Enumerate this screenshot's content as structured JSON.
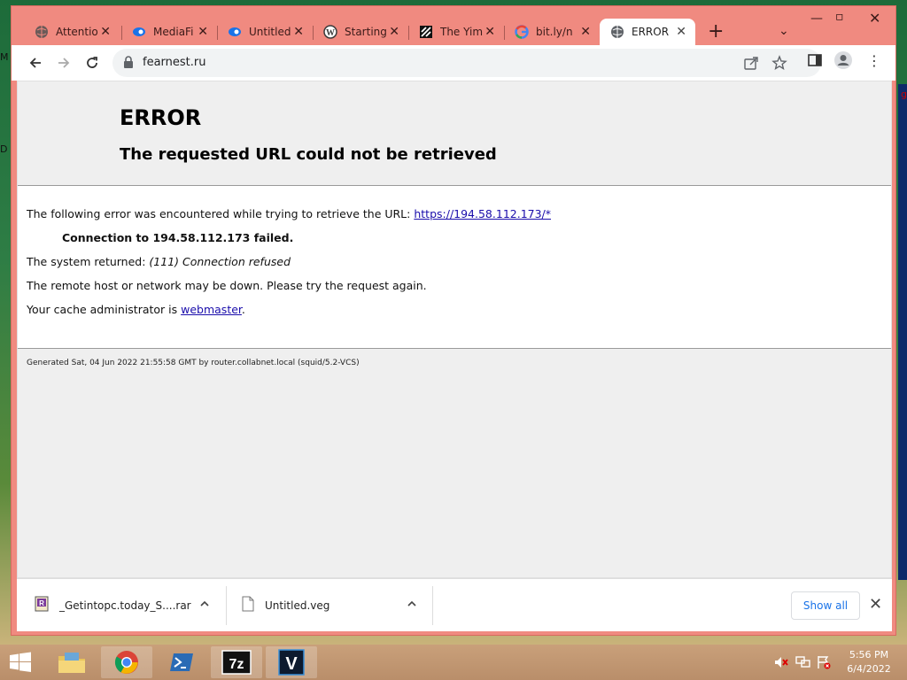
{
  "desktop": {
    "left_labels": [
      "M",
      "D"
    ],
    "right_label": "g"
  },
  "tabs": [
    {
      "title": "Attentio",
      "icon": "globe-icon"
    },
    {
      "title": "MediaFi",
      "icon": "mediafire-icon"
    },
    {
      "title": "Untitled",
      "icon": "mediafire-icon"
    },
    {
      "title": "Starting",
      "icon": "wordpress-icon"
    },
    {
      "title": "The Yim",
      "icon": "site-logo-icon"
    },
    {
      "title": "bit.ly/n",
      "icon": "google-icon"
    },
    {
      "title": "ERROR",
      "icon": "globe-icon",
      "active": true
    }
  ],
  "toolbar": {
    "url": "fearnest.ru"
  },
  "error_page": {
    "title": "ERROR",
    "subtitle": "The requested URL could not be retrieved",
    "line1_text": "The following error was encountered while trying to retrieve the URL: ",
    "line1_link": "https://194.58.112.173/*",
    "strong_line": "Connection to 194.58.112.173 failed.",
    "line3_text": "The system returned: ",
    "line3_italic": "(111) Connection refused",
    "line4": "The remote host or network may be down. Please try the request again.",
    "line5_text": "Your cache administrator is ",
    "line5_link": "webmaster",
    "line5_end": ".",
    "generated": "Generated Sat, 04 Jun 2022 21:55:58 GMT by router.collabnet.local (squid/5.2-VCS)"
  },
  "downloads": {
    "items": [
      {
        "name": "_Getintopc.today_S....rar",
        "icon": "winrar-file-icon"
      },
      {
        "name": "Untitled.veg",
        "icon": "file-icon"
      }
    ],
    "show_all": "Show all"
  },
  "taskbar": {
    "apps": [
      "file-explorer-icon",
      "chrome-icon",
      "powershell-icon",
      "7zip-icon",
      "vegas-icon"
    ],
    "sevenzip_label": "7z",
    "vegas_label": "V",
    "time": "5:56 PM",
    "date": "6/4/2022"
  },
  "colors": {
    "tabstrip": "#f08a80",
    "link": "#1a0dab",
    "show_all_text": "#1a73e8"
  }
}
